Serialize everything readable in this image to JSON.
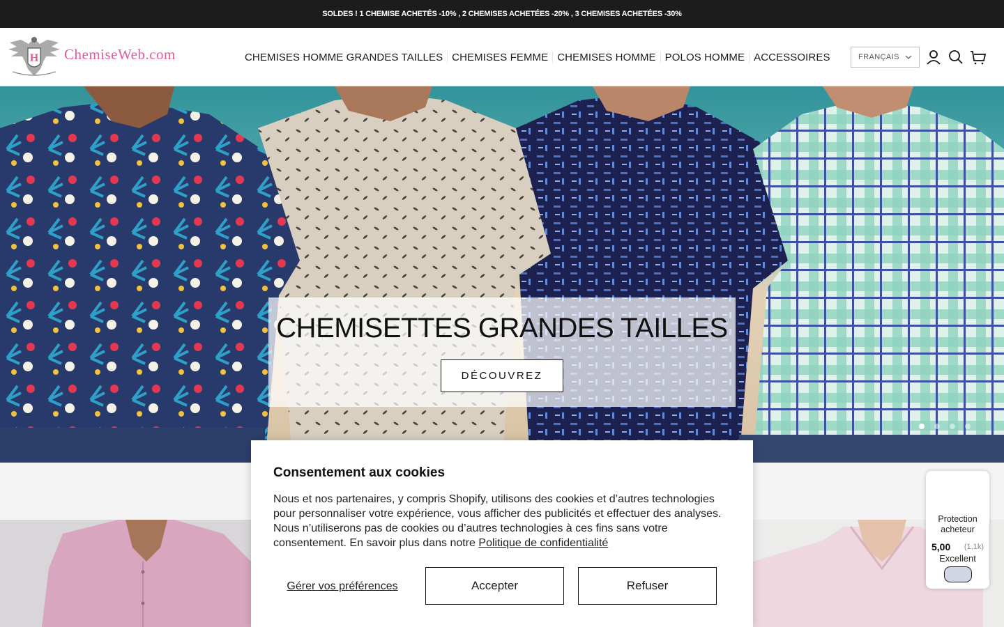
{
  "announcement": {
    "text": "SOLDES ! 1 CHEMISE ACHETÉS -10% , 2 CHEMISES ACHETÉES -20% , 3 CHEMISES ACHETÉES -30%"
  },
  "header": {
    "logo_text": "ChemiseWeb.com",
    "nav": [
      {
        "label": "CHEMISES HOMME GRANDES TAILLES"
      },
      {
        "label": "CHEMISES FEMME"
      },
      {
        "label": "CHEMISES HOMME"
      },
      {
        "label": "POLOS HOMME"
      },
      {
        "label": "ACCESSOIRES"
      }
    ],
    "language": "FRANÇAIS",
    "icons": [
      "account-icon",
      "search-icon",
      "cart-icon"
    ]
  },
  "hero": {
    "title": "CHEMISETTES GRANDES TAILLES",
    "button": "DÉCOUVREZ",
    "slides": 4,
    "active_slide": 1
  },
  "cookie": {
    "title": "Consentement aux cookies",
    "body": "Nous et nos partenaires, y compris Shopify, utilisons des cookies et d’autres technologies pour personnaliser votre expérience, vous afficher des publicités et effectuer des analyses. Nous n’utiliserons pas de cookies ou d’autres technologies à ces fins sans votre consentement. En savoir plus dans notre ",
    "policy_link": "Politique de confidentialité",
    "manage_label": "Gérer vos préférences",
    "accept_label": "Accepter",
    "decline_label": "Refuser"
  },
  "trust_badge": {
    "title": "Protection acheteur",
    "score": "5,00",
    "count": "(1,1k)",
    "label": "Excellent"
  },
  "colors": {
    "announcement_bg": "#1c1c1c",
    "brand_pink": "#e25b9a",
    "text": "#1a1a1a"
  }
}
